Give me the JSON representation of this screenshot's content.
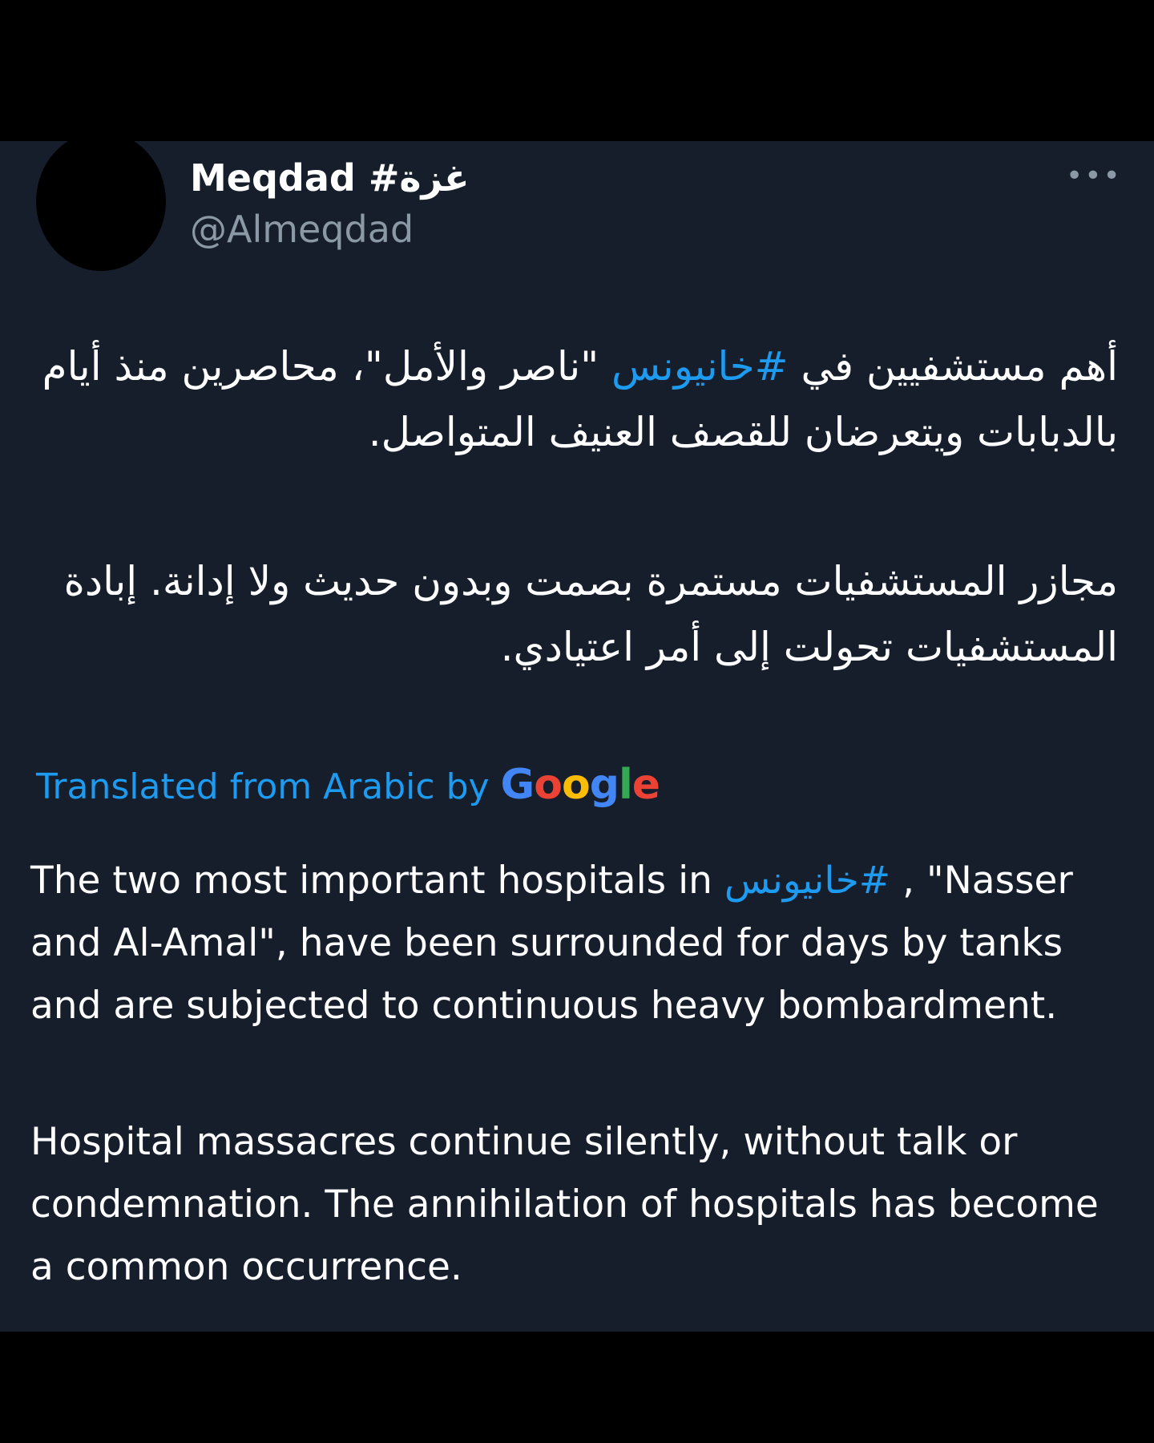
{
  "tweet": {
    "display_name": "Meqdad #غزة",
    "handle": "@Almeqdad",
    "more_icon": "more-horizontal-icon",
    "arabic_p1_before": "أهم مستشفيين في ",
    "arabic_p1_hashtag": "#خانيونس",
    "arabic_p1_after": " \"ناصر والأمل\"، محاصرين منذ أيام بالدبابات ويتعرضان للقصف العنيف المتواصل.",
    "arabic_p2": "مجازر المستشفيات مستمرة بصمت وبدون حديث ولا إدانة. إبادة المستشفيات تحولت إلى أمر اعتيادي.",
    "translated_label": "Translated from Arabic by",
    "google_logo": "Google",
    "google_colors": [
      "#4285F4",
      "#EA4335",
      "#FBBC05",
      "#4285F4",
      "#34A853",
      "#EA4335"
    ],
    "english_p1_before": "The two most important hospitals in ",
    "english_p1_hashtag": "#خانيونس",
    "english_p1_after": " , \"Nasser and Al-Amal\", have been surrounded for days by tanks and are subjected to continuous heavy bombardment.",
    "english_p2": "Hospital massacres continue silently, without talk or condemnation. The annihilation of hospitals has become a common occurrence."
  },
  "colors": {
    "background": "#000000",
    "card": "#161e2b",
    "link": "#1d9bf0",
    "secondary_text": "#8b98a5",
    "primary_text": "#ffffff"
  }
}
